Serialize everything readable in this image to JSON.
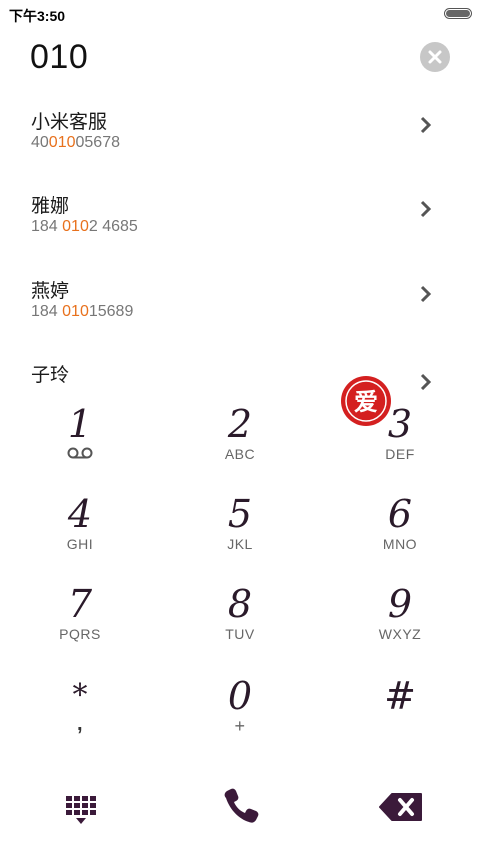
{
  "status_bar": {
    "time": "下午3:50"
  },
  "dialer": {
    "input_value": "010"
  },
  "contacts": [
    {
      "name": "小米客服",
      "number_pre": "40",
      "number_match": "010",
      "number_post": "05678"
    },
    {
      "name": "雅娜",
      "number_pre": "184 ",
      "number_match": "010",
      "number_post": "2 4685"
    },
    {
      "name": "燕婷",
      "number_pre": "184 ",
      "number_match": "010",
      "number_post": "15689"
    },
    {
      "name": "子玲",
      "number_pre": "",
      "number_match": "",
      "number_post": ""
    }
  ],
  "keypad": [
    {
      "digit": "1",
      "letters": "",
      "icon": "voicemail-icon"
    },
    {
      "digit": "2",
      "letters": "ABC"
    },
    {
      "digit": "3",
      "letters": "DEF"
    },
    {
      "digit": "4",
      "letters": "GHI"
    },
    {
      "digit": "5",
      "letters": "JKL"
    },
    {
      "digit": "6",
      "letters": "MNO"
    },
    {
      "digit": "7",
      "letters": "PQRS"
    },
    {
      "digit": "8",
      "letters": "TUV"
    },
    {
      "digit": "9",
      "letters": "WXYZ"
    },
    {
      "digit": "*",
      "letters": ","
    },
    {
      "digit": "0",
      "letters": "+"
    },
    {
      "digit": "#",
      "letters": ""
    }
  ],
  "stamp": {
    "text": "爱"
  },
  "colors": {
    "accent": "#e8711d",
    "icon": "#3b1a3a",
    "stamp": "#d42020"
  },
  "icons": {
    "keypad_toggle": "dialpad-icon",
    "call": "phone-icon",
    "delete": "backspace-icon",
    "clear": "clear-icon",
    "chevron": "chevron-right-icon"
  }
}
